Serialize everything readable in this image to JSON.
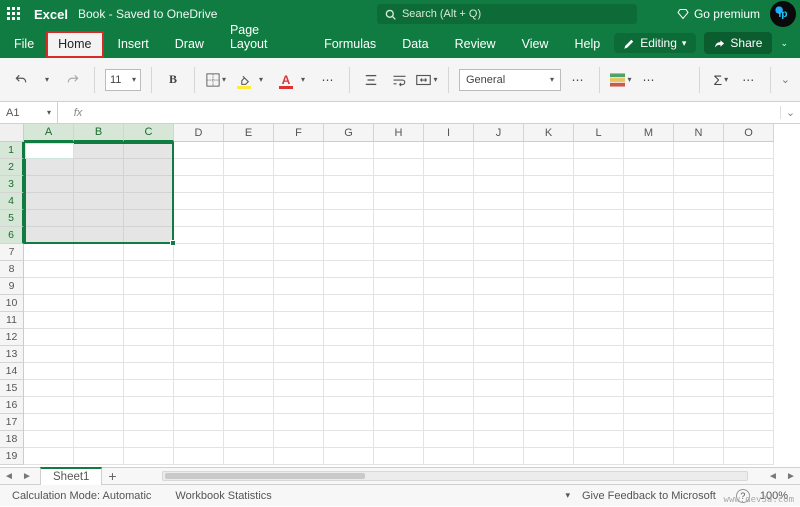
{
  "titlebar": {
    "app_name": "Excel",
    "doc_title": "Book  - Saved to OneDrive",
    "search_placeholder": "Search (Alt + Q)",
    "go_premium": "Go premium",
    "logo_text": "ip"
  },
  "tabs": {
    "file": "File",
    "home": "Home",
    "insert": "Insert",
    "draw": "Draw",
    "page_layout": "Page Layout",
    "formulas": "Formulas",
    "data": "Data",
    "review": "Review",
    "view": "View",
    "help": "Help",
    "editing": "Editing",
    "share": "Share"
  },
  "ribbon": {
    "font_size": "11",
    "bold": "B",
    "number_format": "General",
    "autosum": "Σ"
  },
  "formula": {
    "name_box": "A1",
    "fx": "fx",
    "value": ""
  },
  "grid": {
    "cols": [
      "A",
      "B",
      "C",
      "D",
      "E",
      "F",
      "G",
      "H",
      "I",
      "J",
      "K",
      "L",
      "M",
      "N",
      "O"
    ],
    "rows": [
      "1",
      "2",
      "3",
      "4",
      "5",
      "6",
      "7",
      "8",
      "9",
      "10",
      "11",
      "12",
      "13",
      "14",
      "15",
      "16",
      "17",
      "18",
      "19"
    ],
    "selected_cols": [
      "A",
      "B",
      "C"
    ],
    "selected_rows": [
      "1",
      "2",
      "3",
      "4",
      "5",
      "6"
    ],
    "active_cell": "A1"
  },
  "sheet": {
    "name": "Sheet1"
  },
  "status": {
    "calc_mode": "Calculation Mode: Automatic",
    "wb_stats": "Workbook Statistics",
    "feedback": "Give Feedback to Microsoft",
    "zoom": "100%"
  },
  "watermark": "www.dev3a.com"
}
